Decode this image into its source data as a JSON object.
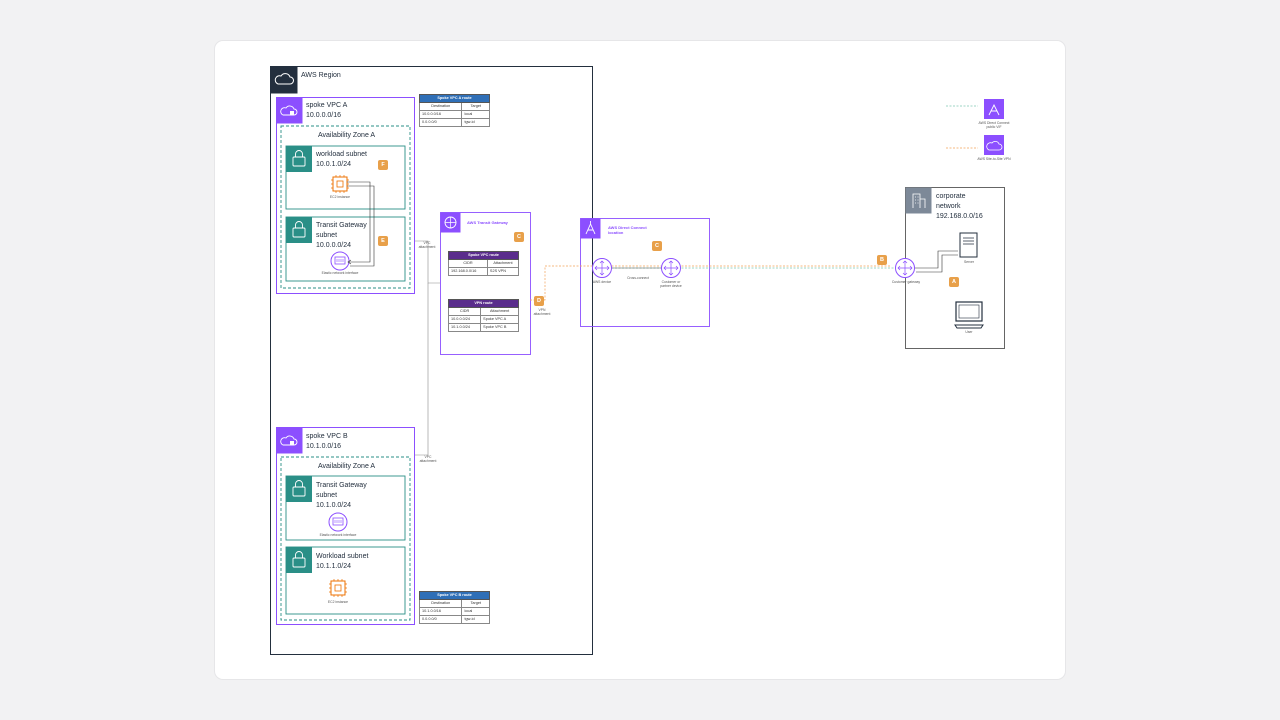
{
  "region": {
    "label": "AWS Region"
  },
  "vpc_a": {
    "title": "spoke VPC A",
    "cidr": "10.0.0.0/16",
    "az": "Availability Zone A",
    "workload": {
      "title": "workload subnet",
      "cidr": "10.0.1.0/24",
      "badge": "F",
      "instance_label": "EC2 instance"
    },
    "tgw_subnet": {
      "title": "Transit Gateway",
      "title2": "subnet",
      "cidr": "10.0.0.0/24",
      "badge": "E",
      "eni_label": "Elastic network interface"
    }
  },
  "vpc_b": {
    "title": "spoke VPC B",
    "cidr": "10.1.0.0/16",
    "az": "Availability Zone A",
    "tgw_subnet": {
      "title": "Transit Gateway",
      "title2": "subnet",
      "cidr": "10.1.0.0/24",
      "eni_label": "Elastic network interface"
    },
    "workload": {
      "title": "Workload subnet",
      "cidr": "10.1.1.0/24",
      "instance_label": "EC2 instance"
    }
  },
  "route_a": {
    "title": "Spoke VPC A route",
    "headers": [
      "Destination",
      "Target"
    ],
    "rows": [
      [
        "10.0.0.0/16",
        "local"
      ],
      [
        "0.0.0.0/0",
        "tgw-id"
      ]
    ]
  },
  "route_b": {
    "title": "Spoke VPC B route",
    "headers": [
      "Destination",
      "Target"
    ],
    "rows": [
      [
        "10.1.0.0/16",
        "local"
      ],
      [
        "0.0.0.0/0",
        "tgw-id"
      ]
    ]
  },
  "tgw": {
    "title": "AWS Transit Gateway",
    "badge": "C",
    "spoke_route": {
      "title": "Spoke VPC route",
      "headers": [
        "CIDR",
        "Attachment"
      ],
      "rows": [
        [
          "192.168.0.0/16",
          "S2S VPN"
        ]
      ]
    },
    "vpn_route": {
      "title": "VPN route",
      "headers": [
        "CIDR",
        "Attachment"
      ],
      "rows": [
        [
          "10.0.0.0/24",
          "Spoke VPC A"
        ],
        [
          "10.1.0.0/24",
          "Spoke VPC B"
        ]
      ]
    }
  },
  "attachments": {
    "vpc_a": "VPC attachment",
    "vpc_b": "VPC attachment",
    "vpn": "VPN attachment",
    "vpn_badge": "D"
  },
  "dx": {
    "title": "AWS Direct Connect",
    "title2": "location",
    "badge": "C",
    "aws_device": "AWS device",
    "cross_connect": "Cross-connect",
    "customer_device": "Customer or partner device"
  },
  "corp": {
    "title": "corporate",
    "title2": "network",
    "cidr": "192.168.0.0/16",
    "gateway": "Customer gateway",
    "gateway_badge": "B",
    "server": "Server",
    "server_badge": "A",
    "client": "User"
  },
  "legend": {
    "item1": "AWS Direct Connect public VIF",
    "item2": "AWS Site-to-Site VPN"
  },
  "colors": {
    "vpc": "#8c4fff",
    "subnet": "#2a8f87",
    "region": "#232f3e",
    "ec2": "#ed7100",
    "badge": "#e8a04a",
    "vpn_line": "#f3a25a",
    "dx_line": "#7fc6b3"
  }
}
